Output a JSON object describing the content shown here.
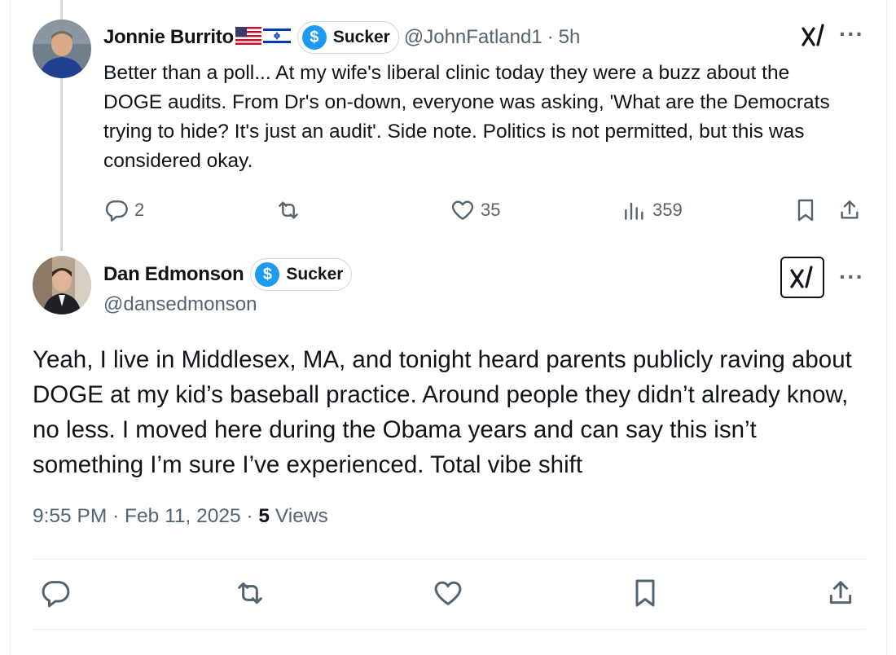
{
  "parent_tweet": {
    "display_name": "Jonnie Burrito",
    "flags": [
      "us-flag",
      "israel-flag"
    ],
    "badge_label": "Sucker",
    "badge_icon": "dollar-icon",
    "handle": "@JohnFatland1",
    "separator": "·",
    "time": "5h",
    "text": "Better than a poll... At my wife's liberal clinic today they were a buzz about the DOGE audits. From Dr's on-down, everyone was asking, 'What are the Democrats trying to hide? It's just an audit'. Side note. Politics is not permitted, but this was considered okay.",
    "actions": {
      "reply_count": "2",
      "retweet_count": "",
      "like_count": "35",
      "views_count": "359"
    }
  },
  "main_tweet": {
    "display_name": "Dan Edmonson",
    "badge_label": "Sucker",
    "badge_icon": "dollar-icon",
    "handle": "@dansedmonson",
    "text": "Yeah, I live in Middlesex, MA, and tonight heard parents publicly raving about DOGE at my kid’s baseball practice. Around people they didn’t already know, no less. I moved here during the Obama years and can say this isn’t something I’m sure I’ve experienced. Total vibe shift",
    "time": "9:55 PM",
    "date": "Feb 11, 2025",
    "separator": "·",
    "views_count": "5",
    "views_label": "Views"
  },
  "colors": {
    "text_primary": "#0f1419",
    "text_secondary": "#536471",
    "badge_blue": "#1d9bf0",
    "border": "#cfd9de",
    "divider": "#eff3f4"
  }
}
